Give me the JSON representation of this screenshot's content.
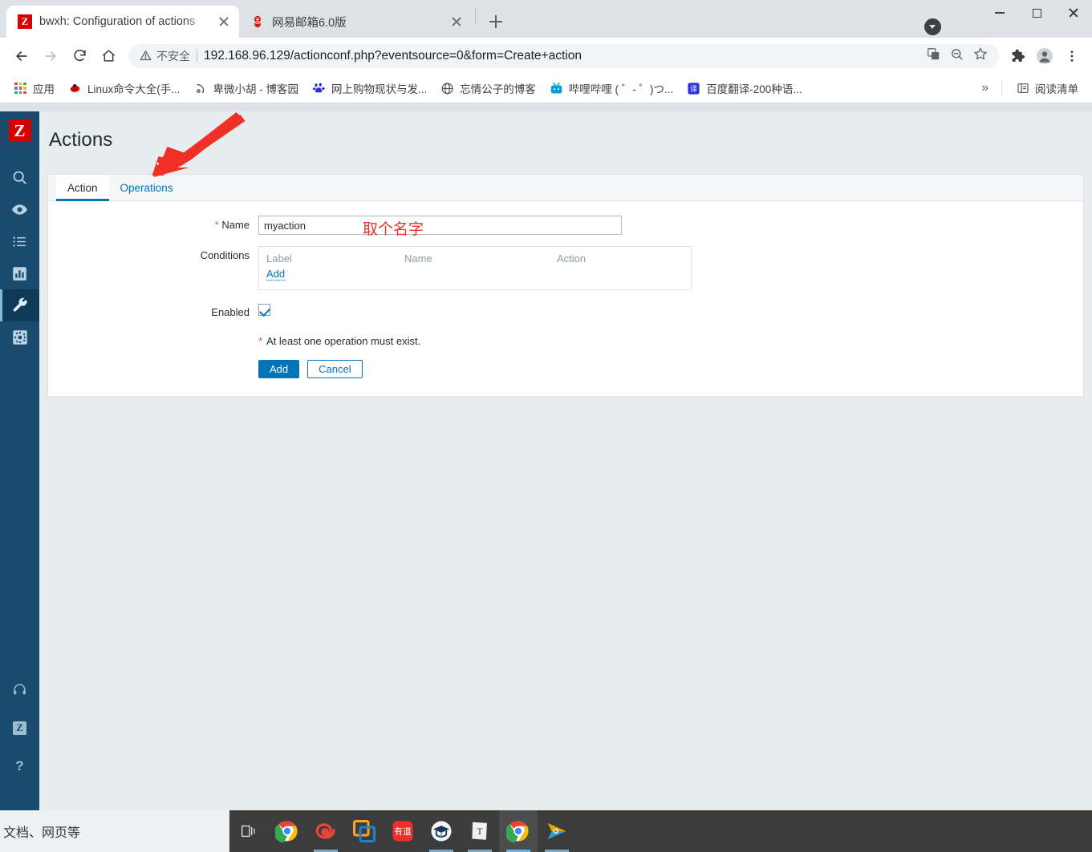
{
  "browser": {
    "tabs": [
      {
        "title": "bwxh: Configuration of actions",
        "favicon": "zabbix-z-icon",
        "active": true,
        "close_label": "close-tab"
      },
      {
        "title": "网易邮箱6.0版",
        "favicon": "netease-mail-icon",
        "active": false,
        "close_label": "close-tab"
      }
    ],
    "new_tab_label": "new-tab",
    "window_controls": {
      "minimize": "minimize",
      "maximize": "maximize",
      "close": "close"
    },
    "toolbar": {
      "back": "back",
      "forward": "forward",
      "reload": "reload",
      "home": "home",
      "security_label": "不安全",
      "url": "192.168.96.129/actionconf.php?eventsource=0&form=Create+action",
      "translate": "translate-icon",
      "zoom_out": "zoom-out-icon",
      "bookmark_star": "star-icon",
      "extensions": "extensions-icon",
      "profile": "profile-icon",
      "menu": "menu-icon"
    },
    "bookmarks": [
      {
        "label": "应用",
        "icon": "apps-grid-icon"
      },
      {
        "label": "Linux命令大全(手...",
        "icon": "redhat-icon"
      },
      {
        "label": "卑微小胡 - 博客园",
        "icon": "cnblogs-icon"
      },
      {
        "label": "网上购物现状与发...",
        "icon": "baidu-icon"
      },
      {
        "label": "忘情公子的博客",
        "icon": "globe-icon"
      },
      {
        "label": "哔哩哔哩 ( ゜- ゜)つ...",
        "icon": "bilibili-icon"
      },
      {
        "label": "百度翻译-200种语...",
        "icon": "fanyi-icon"
      }
    ],
    "bookmarks_overflow": "»",
    "reading_list": {
      "label": "阅读清单",
      "icon": "reading-list-icon"
    }
  },
  "sidebar": {
    "logo": "Z",
    "items": [
      {
        "name": "search",
        "icon": "search-icon",
        "active": false
      },
      {
        "name": "monitoring",
        "icon": "eye-icon",
        "active": false
      },
      {
        "name": "inventory",
        "icon": "list-icon",
        "active": false
      },
      {
        "name": "reports",
        "icon": "bar-chart-icon",
        "active": false
      },
      {
        "name": "configuration",
        "icon": "wrench-icon",
        "active": true
      },
      {
        "name": "administration",
        "icon": "gear-icon",
        "active": false
      }
    ],
    "bottom_items": [
      {
        "name": "support",
        "icon": "headset-icon"
      },
      {
        "name": "integrations",
        "icon": "zabbix-mini-icon",
        "label": "Z"
      },
      {
        "name": "help",
        "icon": "question-icon",
        "label": "?"
      }
    ]
  },
  "main": {
    "title": "Actions",
    "tabs": [
      {
        "label": "Action",
        "active": true
      },
      {
        "label": "Operations",
        "active": false
      }
    ],
    "form": {
      "name_label": "Name",
      "name_required": "*",
      "name_value": "myaction",
      "name_placeholder": "",
      "conditions_label": "Conditions",
      "conditions_columns": [
        "Label",
        "Name",
        "Action"
      ],
      "conditions_rows": [],
      "conditions_add_link": "Add",
      "enabled_label": "Enabled",
      "enabled_checked": true,
      "hint_required": "*",
      "hint_text": "At least one operation must exist.",
      "submit_label": "Add",
      "cancel_label": "Cancel"
    },
    "annotation": {
      "text": "取个名字",
      "color": "#e8342a",
      "arrow": "red-arrow-pointing-to-operations-tab"
    }
  },
  "taskbar": {
    "search_placeholder": "文档、网页等",
    "items": [
      {
        "name": "task-view",
        "icon": "task-view-icon",
        "running": false,
        "active": false
      },
      {
        "name": "google-chrome",
        "icon": "chrome-icon",
        "running": false,
        "active": false
      },
      {
        "name": "mobaxterm",
        "icon": "spiral-icon",
        "running": true,
        "active": false
      },
      {
        "name": "vmware-workstation",
        "icon": "vmware-icon",
        "running": false,
        "active": false
      },
      {
        "name": "youdao-dict",
        "icon": "youdao-icon",
        "running": false,
        "active": false
      },
      {
        "name": "xuexi",
        "icon": "graduation-cap-icon",
        "running": true,
        "active": false
      },
      {
        "name": "typora",
        "icon": "typora-icon",
        "running": true,
        "active": false
      },
      {
        "name": "google-chrome-window",
        "icon": "chrome-icon",
        "running": true,
        "active": true
      },
      {
        "name": "media-player",
        "icon": "play-icon",
        "running": true,
        "active": false
      }
    ]
  },
  "colors": {
    "zabbix_blue": "#0275b8",
    "sidebar_bg": "#1a4b6e",
    "annotation_red": "#e8342a",
    "required_red": "#d85348",
    "page_bg": "#e7ecef"
  }
}
